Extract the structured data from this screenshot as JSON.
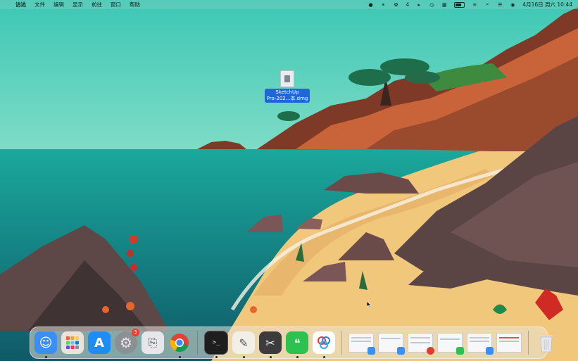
{
  "menubar": {
    "apple_icon": "apple-icon",
    "app_name": "访达",
    "items": [
      "文件",
      "编辑",
      "显示",
      "前往",
      "窗口",
      "帮助"
    ],
    "status": {
      "wechat_count": "4",
      "date_time": "4月16日 周六  10:44"
    }
  },
  "desktop": {
    "file_name_line1": "SketchUp",
    "file_name_line2": "Pro-202...本.dmg"
  },
  "dock": {
    "apps": [
      {
        "name": "finder",
        "icon": "finder-icon",
        "color": "#3a8ef6",
        "running": true
      },
      {
        "name": "launchpad",
        "icon": "launchpad-icon",
        "color": "#e9e3da",
        "running": false
      },
      {
        "name": "app-store",
        "icon": "app-store-icon",
        "color": "#1d8df5",
        "running": false
      },
      {
        "name": "system-preferences",
        "icon": "gear-icon",
        "color": "#8c8f94",
        "running": false,
        "badge": "3"
      },
      {
        "name": "preview",
        "icon": "preview-icon",
        "color": "#e6e7ea",
        "running": false
      },
      {
        "name": "chrome",
        "icon": "chrome-icon",
        "color": "#ffffff",
        "running": true
      },
      {
        "name": "terminal",
        "icon": "terminal-icon",
        "color": "#1e1e1e",
        "running": true
      },
      {
        "name": "textedit",
        "icon": "textedit-icon",
        "color": "#f1efe8",
        "running": true
      },
      {
        "name": "screenshot",
        "icon": "screenshot-icon",
        "color": "#3c3c3c",
        "running": true
      },
      {
        "name": "wechat",
        "icon": "wechat-icon",
        "color": "#2dc14f",
        "running": true
      },
      {
        "name": "baidu-netdisk",
        "icon": "netdisk-icon",
        "color": "#ffffff",
        "running": true
      }
    ],
    "thumbnails": [
      {
        "mini_color": "#3a8ef6"
      },
      {
        "mini_color": "#3a8ef6"
      },
      {
        "mini_color": "#e53b2f"
      },
      {
        "mini_color": "#2dc14f"
      },
      {
        "mini_color": "#3a8ef6"
      },
      {
        "mini_color": "#f6f7f8"
      }
    ]
  }
}
